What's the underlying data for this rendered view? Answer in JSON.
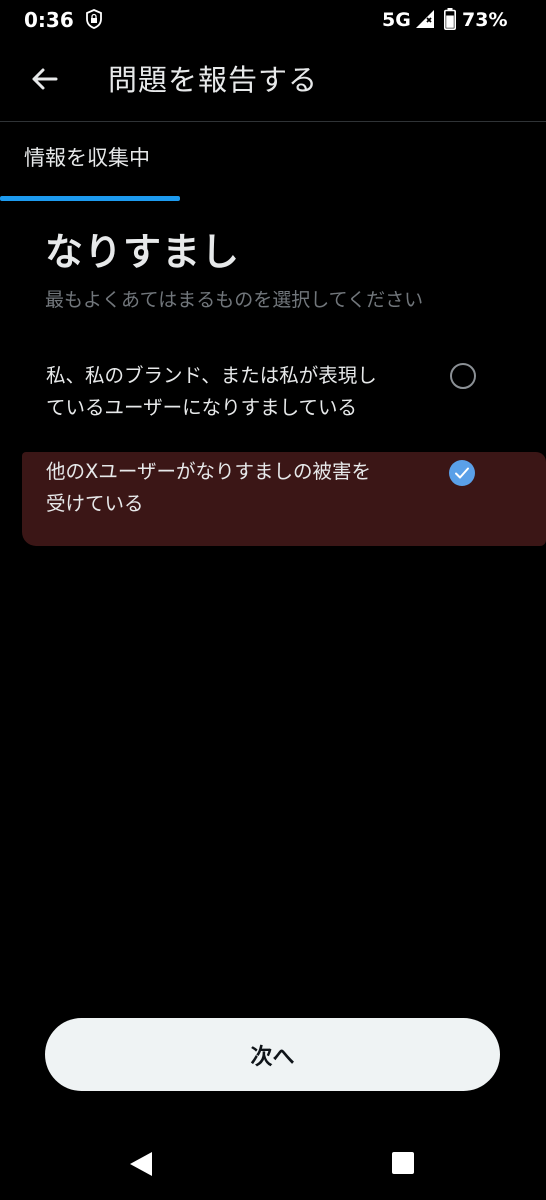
{
  "status_bar": {
    "time": "0:36",
    "network": "5G",
    "battery_percent": "73%",
    "icons": [
      "shield-lock-icon",
      "signal-icon",
      "battery-icon"
    ]
  },
  "header": {
    "back_icon": "arrow-left-icon",
    "title": "問題を報告する"
  },
  "tab": {
    "label": "情報を収集中",
    "accent_color": "#1d9bf0"
  },
  "section": {
    "title": "なりすまし",
    "subtitle": "最もよくあてはまるものを選択してください"
  },
  "options": [
    {
      "label_line1": "私、私のブランド、または私が表現し",
      "label_line2": "ているユーザーになりすましている",
      "selected": false
    },
    {
      "label_line1": "他のXユーザーがなりすましの被害を",
      "label_line2": "受けている",
      "selected": true
    }
  ],
  "next_button": {
    "label": "次へ"
  },
  "colors": {
    "background": "#000000",
    "selected_radio": "#5aa0e8",
    "redaction": "#3b1616",
    "button_bg": "#eff3f4"
  }
}
